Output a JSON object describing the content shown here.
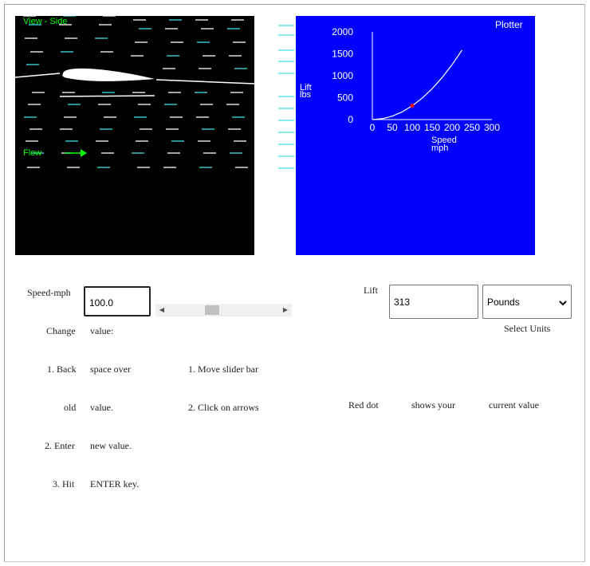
{
  "view": {
    "title": "View - Side",
    "flow_label": "Flow"
  },
  "plotter": {
    "title": "Plotter",
    "ylabel_line1": "Lift",
    "ylabel_line2": "lbs",
    "xlabel_line1": "Speed",
    "xlabel_line2": "mph",
    "y_ticks": [
      "2000",
      "1500",
      "1000",
      "500",
      "0"
    ],
    "x_ticks": [
      "0",
      "50",
      "100",
      "150",
      "200",
      "250",
      "300"
    ]
  },
  "chart_data": {
    "type": "line",
    "title": "Plotter",
    "xlabel": "Speed mph",
    "ylabel": "Lift lbs",
    "xlim": [
      0,
      300
    ],
    "ylim": [
      0,
      2000
    ],
    "series": [
      {
        "x": [
          0,
          25,
          50,
          75,
          100,
          125,
          150,
          175,
          200,
          225
        ],
        "y": [
          0,
          20,
          78,
          176,
          313,
          489,
          704,
          958,
          1252,
          1584
        ]
      }
    ],
    "current_point": {
      "x": 100,
      "y": 313
    },
    "grid": false,
    "colors": {
      "background": "#0000ff",
      "curve": "#ffffff",
      "current_point": "#ff0000"
    }
  },
  "controls": {
    "speed_label": "Speed-mph",
    "speed_value": "100.0",
    "speed_slider_fraction": 0.38,
    "lift_label": "Lift",
    "lift_value": "313",
    "units_value": "Pounds",
    "units_caption": "Select Units"
  },
  "instructions": {
    "change_a": "Change",
    "change_b": "value:",
    "step1_a": "1. Back",
    "step1_b": "space over",
    "step1_c": "old",
    "step1_d": "value.",
    "step2_a": "2. Enter",
    "step2_b": "new value.",
    "step3_a": "3. Hit",
    "step3_b": "ENTER key.",
    "alt1": "1. Move slider bar",
    "alt2": "2. Click on arrows",
    "red_dot_a": "Red dot",
    "red_dot_b": "shows your",
    "red_dot_c": "current value"
  }
}
